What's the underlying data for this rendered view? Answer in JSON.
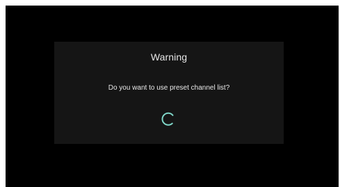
{
  "dialog": {
    "title": "Warning",
    "message": "Do you want to use preset channel list?",
    "spinner_icon": "loading-spinner-icon",
    "spinner_color": "#7fd6c8"
  },
  "colors": {
    "screen_background": "#000000",
    "dialog_background": "#151515",
    "text": "#e6e6e6"
  }
}
